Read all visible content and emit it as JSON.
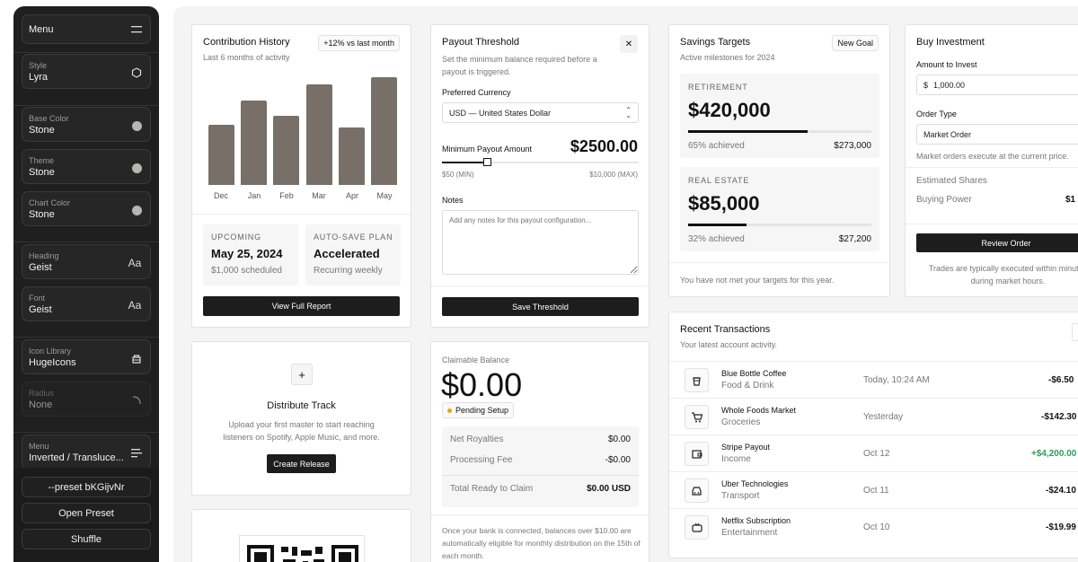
{
  "sidebar": {
    "menu_label": "Menu",
    "items": [
      {
        "label": "Style",
        "value": "Lyra",
        "icon": "hexagon-icon"
      },
      {
        "label": "Base Color",
        "value": "Stone",
        "icon": "color-dot-icon"
      },
      {
        "label": "Theme",
        "value": "Stone",
        "icon": "color-dot-icon"
      },
      {
        "label": "Chart Color",
        "value": "Stone",
        "icon": "color-dot-icon"
      },
      {
        "label": "Heading",
        "value": "Geist",
        "icon": "Aa"
      },
      {
        "label": "Font",
        "value": "Geist",
        "icon": "Aa"
      },
      {
        "label": "Icon Library",
        "value": "HugeIcons",
        "icon": "library-icon"
      },
      {
        "label": "Radius",
        "value": "None",
        "icon": "radius-icon"
      },
      {
        "label": "Menu",
        "value": "Inverted / Transluce...",
        "icon": "menu-lines-icon"
      }
    ],
    "buttons": {
      "preset": "--preset bKGijvNr",
      "open": "Open Preset",
      "shuffle": "Shuffle"
    },
    "colors": {
      "dot": "#b8b5b0"
    }
  },
  "contribution": {
    "title": "Contribution History",
    "badge": "+12% vs last month",
    "subtitle": "Last 6 months of activity",
    "upcoming_label": "UPCOMING",
    "upcoming_date": "May 25, 2024",
    "upcoming_sub": "$1,000 scheduled",
    "autosave_label": "AUTO-SAVE PLAN",
    "autosave_value": "Accelerated",
    "autosave_sub": "Recurring weekly",
    "button": "View Full Report"
  },
  "chart_data": {
    "type": "bar",
    "categories": [
      "Dec",
      "Jan",
      "Feb",
      "Mar",
      "Apr",
      "May"
    ],
    "values": [
      56,
      78,
      64,
      93,
      53,
      100
    ],
    "ylim": [
      0,
      100
    ],
    "grid": false,
    "color": "#787068"
  },
  "distribute": {
    "plus": "+",
    "title": "Distribute Track",
    "text": "Upload your first master to start reaching listeners on Spotify, Apple Music, and more.",
    "button": "Create Release"
  },
  "payout": {
    "title": "Payout Threshold",
    "close": "✕",
    "subtitle": "Set the minimum balance required before a payout is triggered.",
    "currency_label": "Preferred Currency",
    "currency_value": "USD — United States Dollar",
    "min_label": "Minimum Payout Amount",
    "min_value": "$2500.00",
    "slider_fraction": 0.23,
    "slider_min": "$50 (MIN)",
    "slider_max": "$10,000 (MAX)",
    "notes_label": "Notes",
    "notes_placeholder": "Add any notes for this payout configuration...",
    "button": "Save Threshold"
  },
  "claim": {
    "label": "Claimable Balance",
    "amount": "$0.00",
    "status": "Pending Setup",
    "status_color": "#e0a800",
    "rows": [
      {
        "label": "Net Royalties",
        "value": "$0.00"
      },
      {
        "label": "Processing Fee",
        "value": "-$0.00"
      }
    ],
    "total_label": "Total Ready to Claim",
    "total_value": "$0.00 USD",
    "footer": "Once your bank is connected, balances over $10.00 are automatically eligible for monthly distribution on the 15th of each month."
  },
  "savings": {
    "title": "Savings Targets",
    "button": "New Goal",
    "subtitle": "Active milestones for 2024",
    "targets": [
      {
        "label": "RETIREMENT",
        "amount": "$420,000",
        "progress": 0.65,
        "achieved": "65% achieved",
        "current": "$273,000"
      },
      {
        "label": "REAL ESTATE",
        "amount": "$85,000",
        "progress": 0.32,
        "achieved": "32% achieved",
        "current": "$27,200"
      }
    ],
    "footer": "You have not met your targets for this year."
  },
  "invest": {
    "title": "Buy Investment",
    "amount_label": "Amount to Invest",
    "currency": "$",
    "amount_value": "1,000.00",
    "order_label": "Order Type",
    "order_value": "Market Order",
    "order_hint": "Market orders execute at the current price.",
    "shares_label": "Estimated Shares",
    "power_label": "Buying Power",
    "power_value": "$1",
    "button": "Review Order",
    "footer": "Trades are typically executed within minutes during market hours."
  },
  "transactions": {
    "title": "Recent Transactions",
    "subtitle": "Your latest account activity.",
    "positive_color": "#2a9d5c",
    "rows": [
      {
        "icon": "coffee-cup-icon",
        "glyph": "☕",
        "name": "Blue Bottle Coffee",
        "category": "Food & Drink",
        "date": "Today, 10:24 AM",
        "amount": "-$6.50",
        "positive": false
      },
      {
        "icon": "shopping-cart-icon",
        "glyph": "🛒",
        "name": "Whole Foods Market",
        "category": "Groceries",
        "date": "Yesterday",
        "amount": "-$142.30",
        "positive": false
      },
      {
        "icon": "wallet-icon",
        "glyph": "▣",
        "name": "Stripe Payout",
        "category": "Income",
        "date": "Oct 12",
        "amount": "+$4,200.00",
        "positive": true
      },
      {
        "icon": "car-icon",
        "glyph": "🚗",
        "name": "Uber Technologies",
        "category": "Transport",
        "date": "Oct 11",
        "amount": "-$24.10",
        "positive": false
      },
      {
        "icon": "tv-icon",
        "glyph": "📺",
        "name": "Netflix Subscription",
        "category": "Entertainment",
        "date": "Oct 10",
        "amount": "-$19.99",
        "positive": false
      }
    ]
  }
}
